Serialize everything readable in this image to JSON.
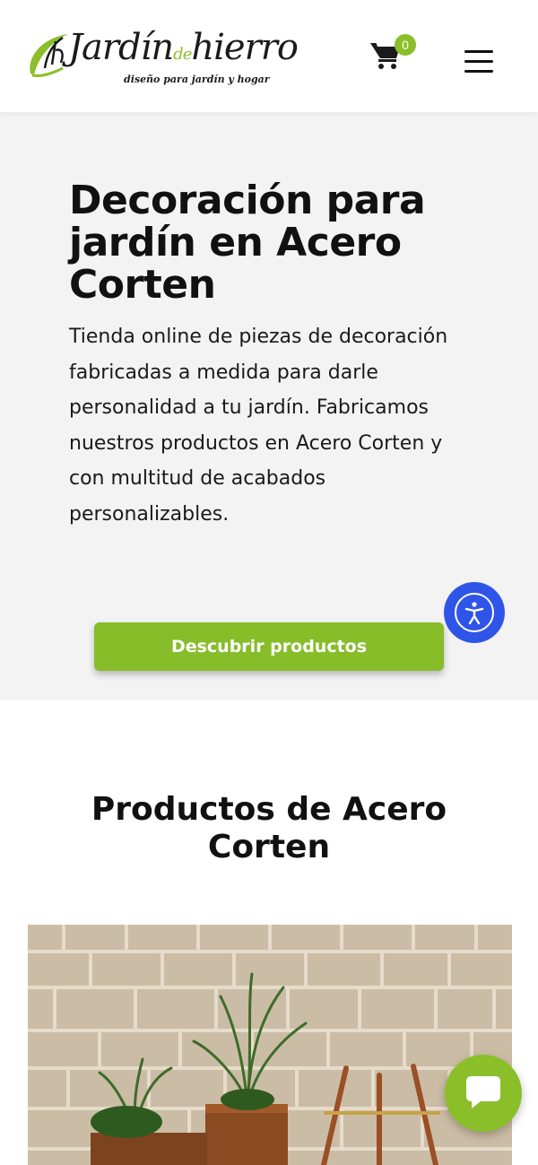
{
  "header": {
    "logo": {
      "word": "Jardín",
      "de": "de",
      "word2": "hierro",
      "tagline": "diseño para jardín y hogar"
    },
    "cart": {
      "count": "0",
      "icon": "cart-icon"
    },
    "menu": {
      "icon": "hamburger-menu-icon"
    }
  },
  "hero": {
    "title": "Decoración para jardín en Acero Corten",
    "description": "Tienda online de piezas de decoración fabricadas a medida para darle personalidad a tu jardín. Fabricamos nuestros productos en Acero Corten y con multitud de acabados personalizables.",
    "cta_label": "Descubrir productos"
  },
  "products": {
    "title": "Productos de Acero Corten",
    "image": "product-photo"
  },
  "widgets": {
    "accessibility_icon": "accessibility-icon",
    "chat_icon": "chat-bubble-icon"
  },
  "colors": {
    "brand_green": "#86bd29",
    "accessibility_blue": "#2f55e8",
    "hero_bg": "#f3f3f3"
  }
}
